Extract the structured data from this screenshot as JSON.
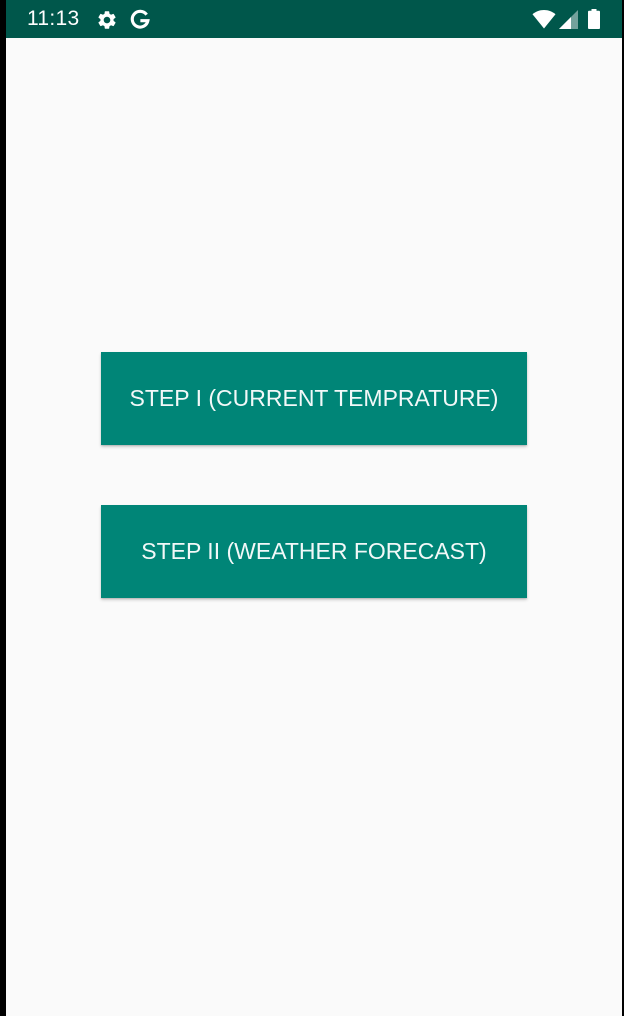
{
  "status_bar": {
    "time": "11:13",
    "background_color": "#00574b",
    "left_icons": [
      "gear-icon",
      "google-g-icon"
    ],
    "right_icons": [
      "wifi-icon",
      "cellular-signal-icon",
      "battery-icon"
    ]
  },
  "main": {
    "background_color": "#fafafa",
    "buttons": [
      {
        "label": "STEP I (CURRENT TEMPRATURE)",
        "color": "#008577"
      },
      {
        "label": "STEP II (WEATHER FORECAST)",
        "color": "#008577"
      }
    ]
  }
}
